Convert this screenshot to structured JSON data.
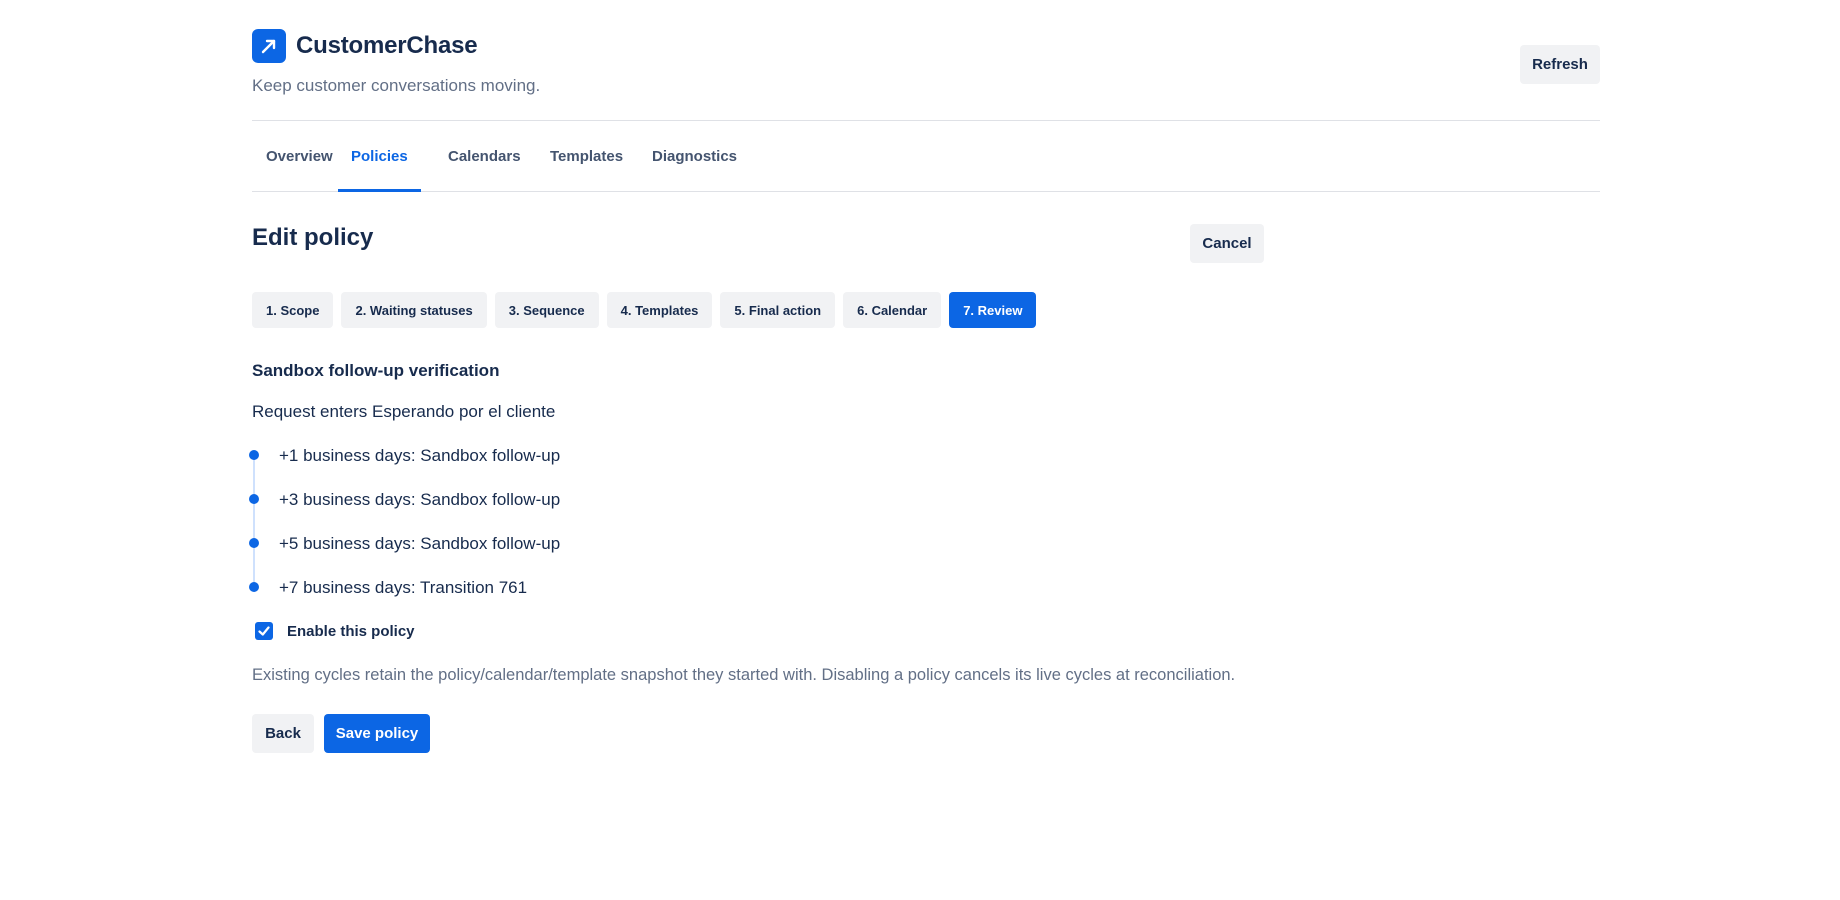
{
  "app": {
    "title": "CustomerChase",
    "tagline": "Keep customer conversations moving.",
    "refresh_label": "Refresh",
    "logo_icon": "arrow-up-right-icon",
    "accent_color": "#0c66e4"
  },
  "tabs": [
    {
      "label": "Overview",
      "active": false
    },
    {
      "label": "Policies",
      "active": true
    },
    {
      "label": "Calendars",
      "active": false
    },
    {
      "label": "Templates",
      "active": false
    },
    {
      "label": "Diagnostics",
      "active": false
    }
  ],
  "editor": {
    "title": "Edit policy",
    "cancel_label": "Cancel",
    "steps": [
      {
        "label": "1. Scope",
        "active": false
      },
      {
        "label": "2. Waiting statuses",
        "active": false
      },
      {
        "label": "3. Sequence",
        "active": false
      },
      {
        "label": "4. Templates",
        "active": false
      },
      {
        "label": "5. Final action",
        "active": false
      },
      {
        "label": "6. Calendar",
        "active": false
      },
      {
        "label": "7. Review",
        "active": true
      }
    ]
  },
  "review": {
    "policy_name": "Sandbox follow-up verification",
    "trigger": "Request enters Esperando por el cliente",
    "timeline": [
      "+1 business days: Sandbox follow-up",
      "+3 business days: Sandbox follow-up",
      "+5 business days: Sandbox follow-up",
      "+7 business days: Transition 761"
    ],
    "enable_label": "Enable this policy",
    "enabled": true,
    "note": "Existing cycles retain the policy/calendar/template snapshot they started with. Disabling a policy cancels its live cycles at reconciliation."
  },
  "actions": {
    "back_label": "Back",
    "save_label": "Save policy"
  }
}
